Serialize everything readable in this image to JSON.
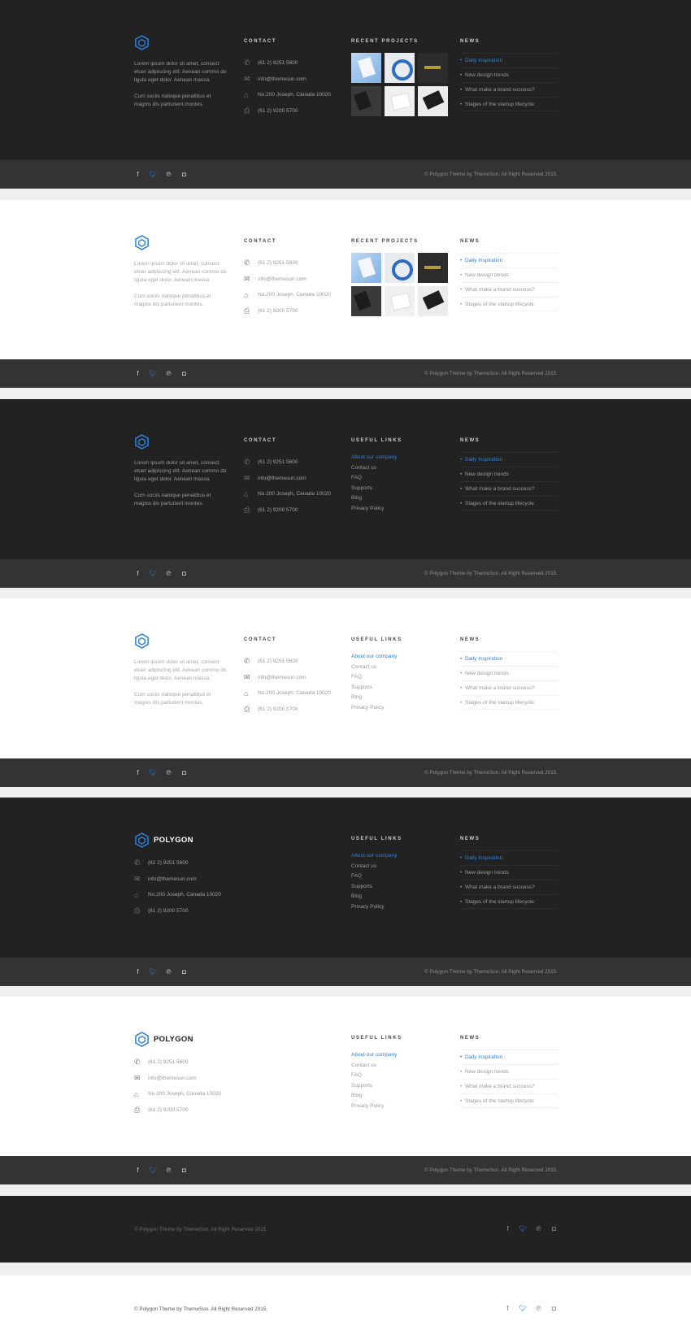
{
  "brand": {
    "name": "POLYGON",
    "accent": "#2f80d6",
    "dark_bg": "#222222",
    "bar_bg": "#333333"
  },
  "headings": {
    "contact": "CONTACT",
    "recent_projects": "RECENT PROJECTS",
    "news": "NEWS",
    "useful_links": "USEFUL LINKS"
  },
  "about": {
    "p1": "Lorem ipsum dolor sit amet, consect etuer adipiscing elit. Aenean commo do ligula eget dolor. Aenean massa.",
    "p2": "Cum sociis natoque penatibus et magnis dis parturient montes."
  },
  "contact": {
    "phone": "(61 2) 9251 5600",
    "email": "info@themesun.com",
    "address": "No.200 Joseph, Canada 10020",
    "fax": "(61 2) 9200 5700",
    "icons": [
      "phone-icon",
      "email-icon",
      "address-icon",
      "fax-icon"
    ]
  },
  "projects": [
    "project-1",
    "project-2",
    "project-3",
    "project-4",
    "project-5",
    "project-6"
  ],
  "links": [
    "About our company",
    "Contact us",
    "FAQ",
    "Supports",
    "Blog",
    "Privacy Policy"
  ],
  "news": [
    "Daily Inspiration",
    "New design trends",
    "What make a brand success?",
    "Stages of the startup lifecycle"
  ],
  "copyright": "© Polygon Theme by ThemeSun. All Right Reserved 2015.",
  "social": [
    "facebook-icon",
    "twitter-icon",
    "pinterest-icon",
    "instagram-icon"
  ]
}
